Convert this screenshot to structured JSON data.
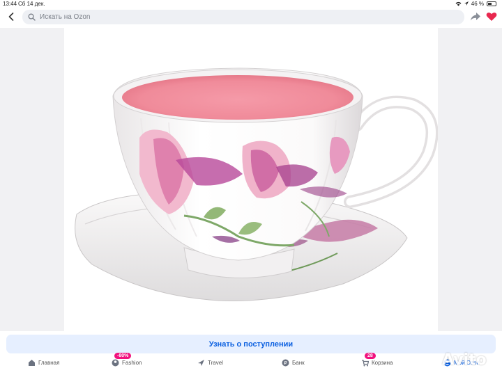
{
  "status_bar": {
    "time": "13:44",
    "date": "Сб 14 дек.",
    "battery": "46 %"
  },
  "header": {
    "search_placeholder": "Искать на Ozon"
  },
  "product": {
    "image_icon": "teacup-with-saucer-magnolia-image"
  },
  "actions": {
    "notify_label": "Узнать о поступлении"
  },
  "bottom_nav": {
    "items": [
      {
        "label": "Главная",
        "icon": "home-icon"
      },
      {
        "label": "Fashion",
        "icon": "fashion-icon",
        "badge": "-80%"
      },
      {
        "label": "Travel",
        "icon": "plane-icon"
      },
      {
        "label": "Банк",
        "icon": "bank-icon"
      },
      {
        "label": "Корзина",
        "icon": "cart-icon",
        "badge": "28"
      },
      {
        "label": "Мой Ozon",
        "icon": "profile-icon"
      }
    ]
  },
  "watermark": {
    "text": "Avito"
  },
  "colors": {
    "accent": "#0a5fe0",
    "badge": "#f1117e",
    "favorite": "#e8284f",
    "notify_bg": "#e6efff"
  }
}
